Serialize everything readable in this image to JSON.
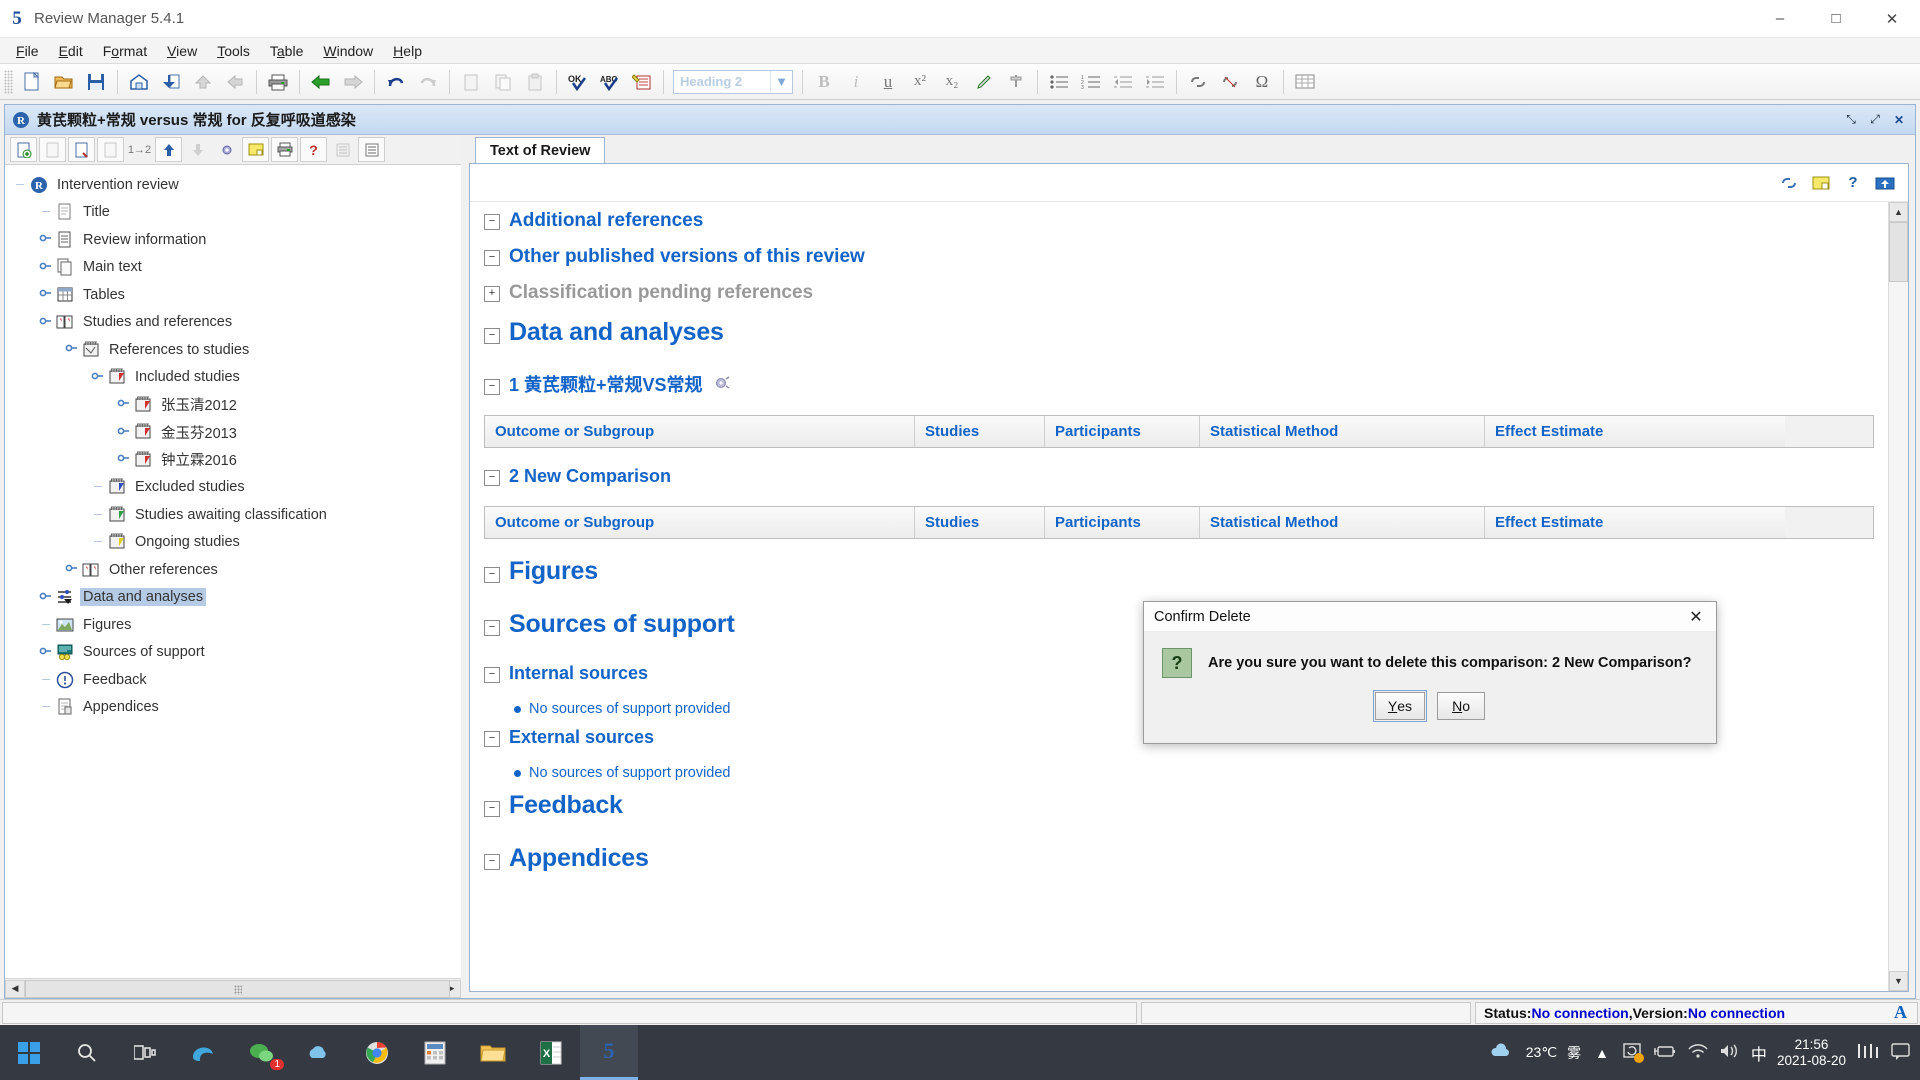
{
  "window": {
    "app_title": "Review Manager 5.4.1",
    "app_logo": "5",
    "minimize": "–",
    "maximize": "□",
    "close": "✕"
  },
  "menubar": {
    "items": [
      "File",
      "Edit",
      "Format",
      "View",
      "Tools",
      "Table",
      "Window",
      "Help"
    ]
  },
  "toolbar": {
    "style_selector_value": "Heading 2",
    "buttons": [
      "new-icon",
      "open-folder-icon",
      "save-icon",
      "home-icon",
      "import-icon",
      "up-arrow-icon",
      "left-arrow-icon",
      "print-icon",
      "back-arrow-icon",
      "forward-arrow-icon",
      "undo-icon",
      "redo-icon",
      "cut-icon",
      "copy-icon",
      "paste-icon",
      "spellcheck-ok-icon",
      "spellcheck-abc-icon",
      "track-changes-icon",
      "bold-icon",
      "italic-icon",
      "underline-icon",
      "superscript-icon",
      "subscript-icon",
      "highlight-icon",
      "pin-icon",
      "bullet-list-icon",
      "numbered-list-icon",
      "decrease-indent-icon",
      "increase-indent-icon",
      "link-icon",
      "unlink-icon",
      "symbol-icon",
      "table-icon"
    ],
    "bold": "B",
    "italic": "i",
    "underline": "u",
    "superscript": "x²",
    "subscript": "x₂"
  },
  "document_window": {
    "title": "黄芪颗粒+常规 versus 常规 for 反复呼吸道感染",
    "restore_label": "⤡",
    "maximize_label": "⤢",
    "close_label": "✕"
  },
  "tree": {
    "toolbar_buttons": [
      "add-icon",
      "edit-icon",
      "properties-icon",
      "assign-icon",
      "merge-1-2-icon",
      "move-up-icon",
      "move-down-icon",
      "settings-icon",
      "note-icon",
      "print-icon",
      "help-icon",
      "list-view-icon",
      "outline-view-icon"
    ],
    "merge_label": "1→2",
    "help_label": "?",
    "items": [
      {
        "label": "Intervention review",
        "depth": 0,
        "icon": "review-icon",
        "expander": "none",
        "selected": false
      },
      {
        "label": "Title",
        "depth": 1,
        "icon": "document-icon",
        "expander": "none",
        "selected": false
      },
      {
        "label": "Review information",
        "depth": 1,
        "icon": "info-document-icon",
        "expander": "collapsed",
        "selected": false
      },
      {
        "label": "Main text",
        "depth": 1,
        "icon": "pages-icon",
        "expander": "collapsed",
        "selected": false
      },
      {
        "label": "Tables",
        "depth": 1,
        "icon": "table-icon",
        "expander": "collapsed",
        "selected": false
      },
      {
        "label": "Studies and references",
        "depth": 1,
        "icon": "book-icon",
        "expander": "expanded",
        "selected": false
      },
      {
        "label": "References to studies",
        "depth": 2,
        "icon": "studies-icon",
        "expander": "expanded",
        "selected": false
      },
      {
        "label": "Included studies",
        "depth": 3,
        "icon": "included-studies-icon",
        "expander": "expanded",
        "selected": false
      },
      {
        "label": "张玉清2012",
        "depth": 4,
        "icon": "study-icon",
        "expander": "collapsed",
        "selected": false
      },
      {
        "label": "金玉芬2013",
        "depth": 4,
        "icon": "study-icon",
        "expander": "collapsed",
        "selected": false
      },
      {
        "label": "钟立霖2016",
        "depth": 4,
        "icon": "study-icon",
        "expander": "collapsed",
        "selected": false
      },
      {
        "label": "Excluded studies",
        "depth": 3,
        "icon": "excluded-studies-icon",
        "expander": "none",
        "selected": false
      },
      {
        "label": "Studies awaiting classification",
        "depth": 3,
        "icon": "awaiting-studies-icon",
        "expander": "none",
        "selected": false
      },
      {
        "label": "Ongoing studies",
        "depth": 3,
        "icon": "ongoing-studies-icon",
        "expander": "none",
        "selected": false
      },
      {
        "label": "Other references",
        "depth": 2,
        "icon": "book-icon",
        "expander": "collapsed",
        "selected": false
      },
      {
        "label": "Data and analyses",
        "depth": 1,
        "icon": "analyses-icon",
        "expander": "collapsed",
        "selected": true
      },
      {
        "label": "Figures",
        "depth": 1,
        "icon": "figures-icon",
        "expander": "none",
        "selected": false
      },
      {
        "label": "Sources of support",
        "depth": 1,
        "icon": "sources-icon",
        "expander": "collapsed",
        "selected": false
      },
      {
        "label": "Feedback",
        "depth": 1,
        "icon": "feedback-icon",
        "expander": "none",
        "selected": false
      },
      {
        "label": "Appendices",
        "depth": 1,
        "icon": "appendices-icon",
        "expander": "none",
        "selected": false
      }
    ]
  },
  "content": {
    "tab_label": "Text of Review",
    "toolbar_buttons": [
      "link-icon",
      "note-icon",
      "help-icon",
      "update-icon"
    ],
    "sections": [
      {
        "kind": "h2",
        "text": "Additional references",
        "toggle": "−"
      },
      {
        "kind": "h2",
        "text": "Other published versions of this review",
        "toggle": "−"
      },
      {
        "kind": "h2g",
        "text": "Classification pending references",
        "toggle": "+"
      },
      {
        "kind": "h1",
        "text": "Data and analyses",
        "toggle": "−"
      },
      {
        "kind": "h3",
        "text": "1 黄芪颗粒+常规VS常规",
        "toggle": "−",
        "icon": "comparison-icon"
      },
      {
        "kind": "table",
        "id": "comparison-1-table"
      },
      {
        "kind": "h3",
        "text": "2 New Comparison",
        "toggle": "−"
      },
      {
        "kind": "table",
        "id": "comparison-2-table"
      },
      {
        "kind": "h1",
        "text": "Figures",
        "toggle": "−"
      },
      {
        "kind": "h1",
        "text": "Sources of support",
        "toggle": "−"
      },
      {
        "kind": "h3",
        "text": "Internal sources",
        "toggle": "−"
      },
      {
        "kind": "bullet",
        "text": "No sources of support provided"
      },
      {
        "kind": "h3",
        "text": "External sources",
        "toggle": "−"
      },
      {
        "kind": "bullet",
        "text": "No sources of support provided"
      },
      {
        "kind": "h1",
        "text": "Feedback",
        "toggle": "−"
      },
      {
        "kind": "h1",
        "text": "Appendices",
        "toggle": "−"
      }
    ],
    "table_headers": [
      "Outcome or Subgroup",
      "Studies",
      "Participants",
      "Statistical Method",
      "Effect Estimate"
    ]
  },
  "dialog": {
    "title": "Confirm Delete",
    "close_label": "✕",
    "icon_glyph": "?",
    "message": "Are you sure you want to delete this comparison: 2 New Comparison?",
    "yes_label": "Yes",
    "no_label": "No"
  },
  "statusbar": {
    "status_prefix": "Status: ",
    "status_value": "No connection",
    "separator": ", ",
    "version_prefix": "Version: ",
    "version_value": "No connection",
    "logo": "A"
  },
  "taskbar": {
    "start_icon": "windows-start-icon",
    "search_icon": "search-icon",
    "taskview_icon": "task-view-icon",
    "apps": [
      "edge-icon",
      "wechat-icon",
      "onedrive-cloud-icon",
      "chrome-icon",
      "calculator-icon",
      "file-explorer-icon",
      "excel-icon",
      "revman-icon"
    ],
    "revman_label": "5",
    "wechat_badge": "1",
    "weather_temp": "23℃",
    "weather_desc": "雾",
    "ime_label": "中",
    "time": "21:56",
    "date": "2021-08-20",
    "tray_icons": [
      "chevron-up-icon",
      "sync-icon",
      "battery-icon",
      "wifi-icon",
      "volume-icon"
    ],
    "right_icons": [
      "m-logo-icon",
      "notifications-icon"
    ]
  }
}
